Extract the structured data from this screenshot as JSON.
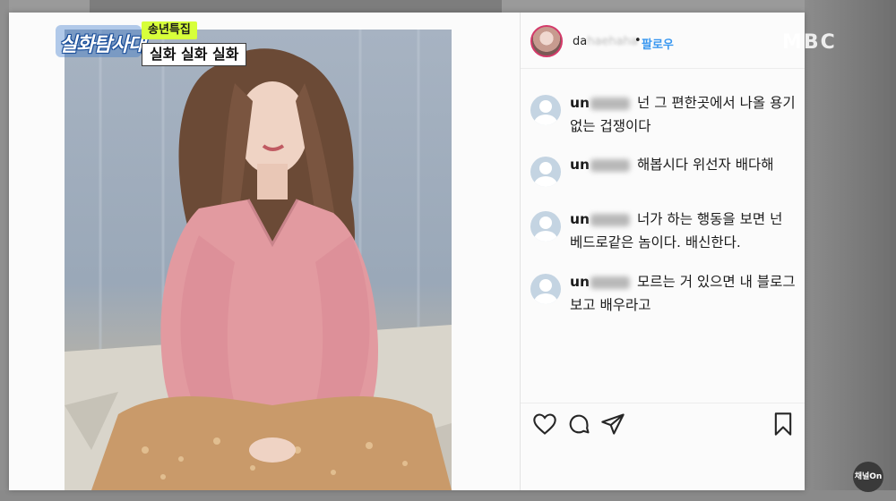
{
  "broadcast": {
    "show_logo": "실화탐사대",
    "caption_tag": "송년특집",
    "caption_main": "실화 실화 실화",
    "network_logo": "MBC",
    "channel_badge": "채널On"
  },
  "post": {
    "header": {
      "username_visible": "da",
      "username_masked": "haehaha",
      "separator": "•",
      "follow_label": "팔로우"
    },
    "comments": [
      {
        "user_prefix": "un",
        "text": "넌 그 편한곳에서 나올 용기없는 겁쟁이다"
      },
      {
        "user_prefix": "un",
        "text": "해봅시다 위선자 배다해"
      },
      {
        "user_prefix": "un",
        "text": "너가 하는 행동을 보면 넌 베드로같은 놈이다. 배신한다."
      },
      {
        "user_prefix": "un",
        "text": "모르는 거 있으면 내 블로그 보고 배우라고"
      }
    ],
    "actions": {
      "like_icon": "heart-icon",
      "comment_icon": "comment-bubble-icon",
      "share_icon": "paper-plane-icon",
      "save_icon": "bookmark-icon"
    }
  },
  "colors": {
    "follow_blue": "#3897f0",
    "caption_tag_bg": "#d7ff3a",
    "story_ring": "#d43a6a",
    "sweater_pink": "#e29aa0",
    "skirt_gold": "#c99a6a"
  }
}
